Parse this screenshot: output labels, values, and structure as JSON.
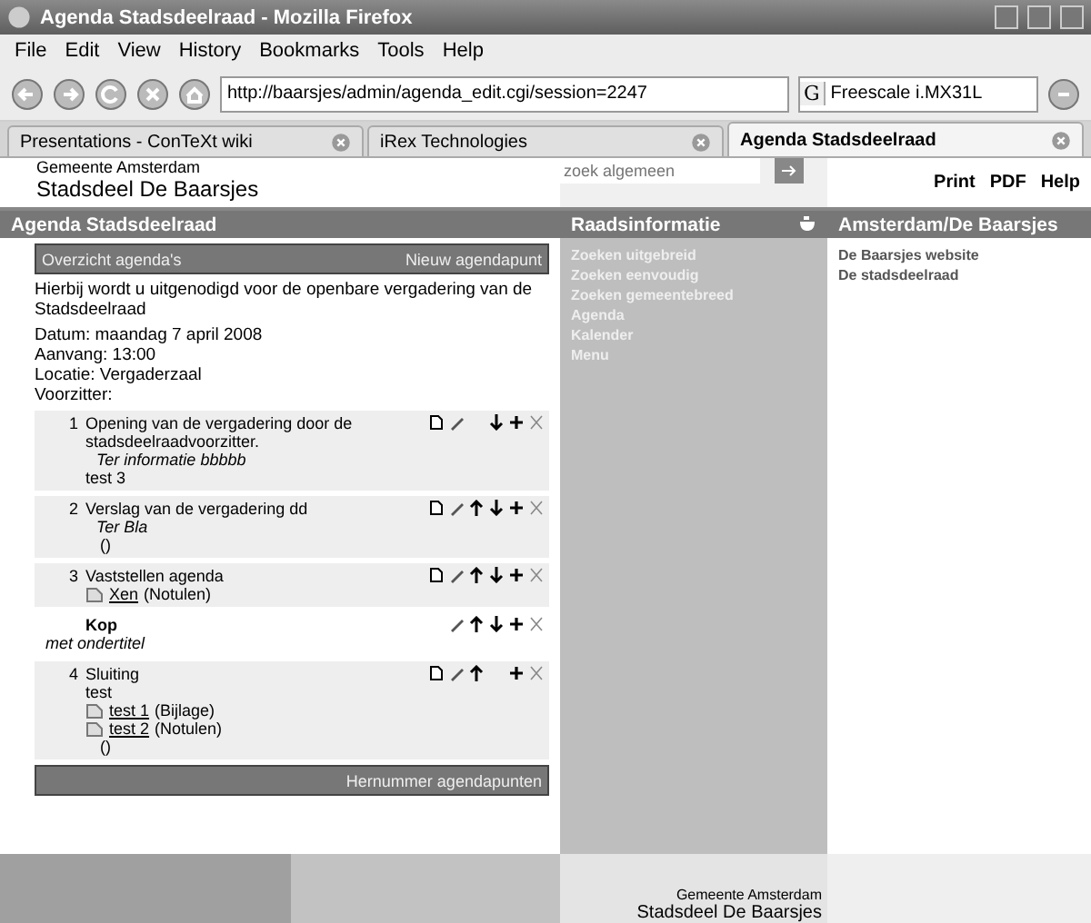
{
  "window": {
    "title": "Agenda Stadsdeelraad - Mozilla Firefox"
  },
  "menu": [
    "File",
    "Edit",
    "View",
    "History",
    "Bookmarks",
    "Tools",
    "Help"
  ],
  "address": {
    "value": "http://baarsjes/admin/agenda_edit.cgi/session=2247"
  },
  "search": {
    "engine": "G",
    "value": "Freescale i.MX31L"
  },
  "tabs": [
    {
      "label": "Presentations - ConTeXt wiki",
      "selected": false
    },
    {
      "label": "iRex Technologies",
      "selected": false
    },
    {
      "label": "Agenda Stadsdeelraad",
      "selected": true
    }
  ],
  "header": {
    "org": "Gemeente Amsterdam",
    "district": "Stadsdeel De Baarsjes",
    "search_placeholder": "zoek algemeen",
    "links": [
      "Print",
      "PDF",
      "Help"
    ]
  },
  "main": {
    "heading": "Agenda Stadsdeelraad",
    "overview_link": "Overzicht agenda's",
    "new_link": "Nieuw agendapunt",
    "intro": "Hierbij wordt u uitgenodigd voor de openbare vergadering van de Stadsdeelraad",
    "details": [
      "Datum: maandag 7 april 2008",
      "Aanvang: 13:00",
      "Locatie: Vergaderzaal",
      "Voorzitter:"
    ],
    "items": [
      {
        "kind": "item",
        "number": "1",
        "title": "Opening van de vergadering door de stadsdeelraadvoorzitter.",
        "actions": {
          "copy": true,
          "edit": true,
          "up": false,
          "down": true
        },
        "lines": [
          {
            "kind": "italic",
            "text": "Ter informatie bbbbb"
          },
          {
            "kind": "plain",
            "text": "test 3"
          }
        ]
      },
      {
        "kind": "item",
        "number": "2",
        "title": "Verslag van de vergadering dd",
        "actions": {
          "copy": true,
          "edit": true,
          "up": true,
          "down": true
        },
        "lines": [
          {
            "kind": "italic",
            "text": "Ter Bla"
          },
          {
            "kind": "indent",
            "text": "()"
          }
        ]
      },
      {
        "kind": "item",
        "number": "3",
        "title": "Vaststellen agenda",
        "actions": {
          "copy": true,
          "edit": true,
          "up": true,
          "down": true
        },
        "lines": [
          {
            "kind": "attachment",
            "link": "Xen",
            "text": "(Notulen)"
          }
        ]
      },
      {
        "kind": "heading",
        "title": "Kop",
        "actions": {
          "copy": false,
          "edit": true,
          "up": true,
          "down": true
        },
        "lines": [
          {
            "kind": "italic",
            "text": "met ondertitel"
          }
        ]
      },
      {
        "kind": "item",
        "number": "4",
        "title": "Sluiting",
        "actions": {
          "copy": true,
          "edit": true,
          "up": true,
          "down": false
        },
        "lines": [
          {
            "kind": "plain",
            "text": "test"
          },
          {
            "kind": "attachment",
            "link": "test 1",
            "text": "(Bijlage)"
          },
          {
            "kind": "attachment",
            "link": "test 2",
            "text": "(Notulen)"
          },
          {
            "kind": "indent",
            "text": "()"
          }
        ]
      }
    ],
    "renumber": "Hernummer agendapunten"
  },
  "raadsinformatie": {
    "heading": "Raadsinformatie",
    "links": [
      "Zoeken uitgebreid",
      "Zoeken eenvoudig",
      "Zoeken gemeentebreed",
      "Agenda",
      "Kalender",
      "Menu"
    ]
  },
  "amsterdam": {
    "heading": "Amsterdam/De Baarsjes",
    "links": [
      "De Baarsjes website",
      "De stadsdeelraad"
    ]
  },
  "footer": {
    "org": "Gemeente Amsterdam",
    "district": "Stadsdeel De Baarsjes"
  }
}
